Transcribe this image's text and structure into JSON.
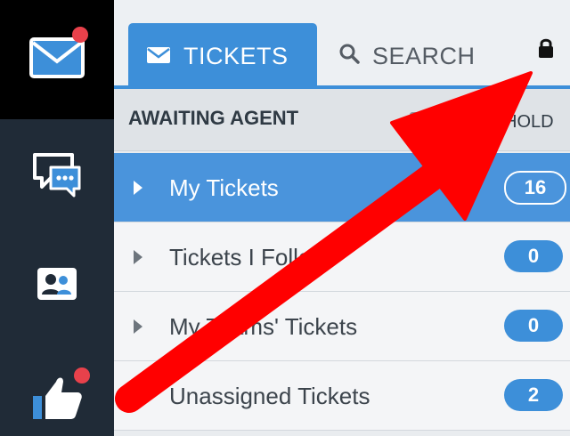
{
  "rail": {
    "items": [
      {
        "icon": "mail-icon",
        "active": true,
        "has_notification": true
      },
      {
        "icon": "chat-icon",
        "active": false,
        "has_notification": false
      },
      {
        "icon": "contacts-icon",
        "active": false,
        "has_notification": false
      },
      {
        "icon": "thumbs-up-icon",
        "active": false,
        "has_notification": true
      }
    ]
  },
  "tabs": {
    "tickets_label": "TICKETS",
    "search_label": "SEARCH"
  },
  "subheader": {
    "title": "AWAITING AGENT",
    "hold_label": "HOLD"
  },
  "ticket_lists": [
    {
      "label": "My Tickets",
      "count": "16",
      "selected": true
    },
    {
      "label": "Tickets I Follow",
      "count": "0",
      "selected": false
    },
    {
      "label": "My Teams' Tickets",
      "count": "0",
      "selected": false
    },
    {
      "label": "Unassigned Tickets",
      "count": "2",
      "selected": false
    }
  ],
  "colors": {
    "accent": "#3d8fd9",
    "rail_bg": "#202b37",
    "notification": "#e8414b",
    "annotation_arrow": "#ff0000"
  }
}
